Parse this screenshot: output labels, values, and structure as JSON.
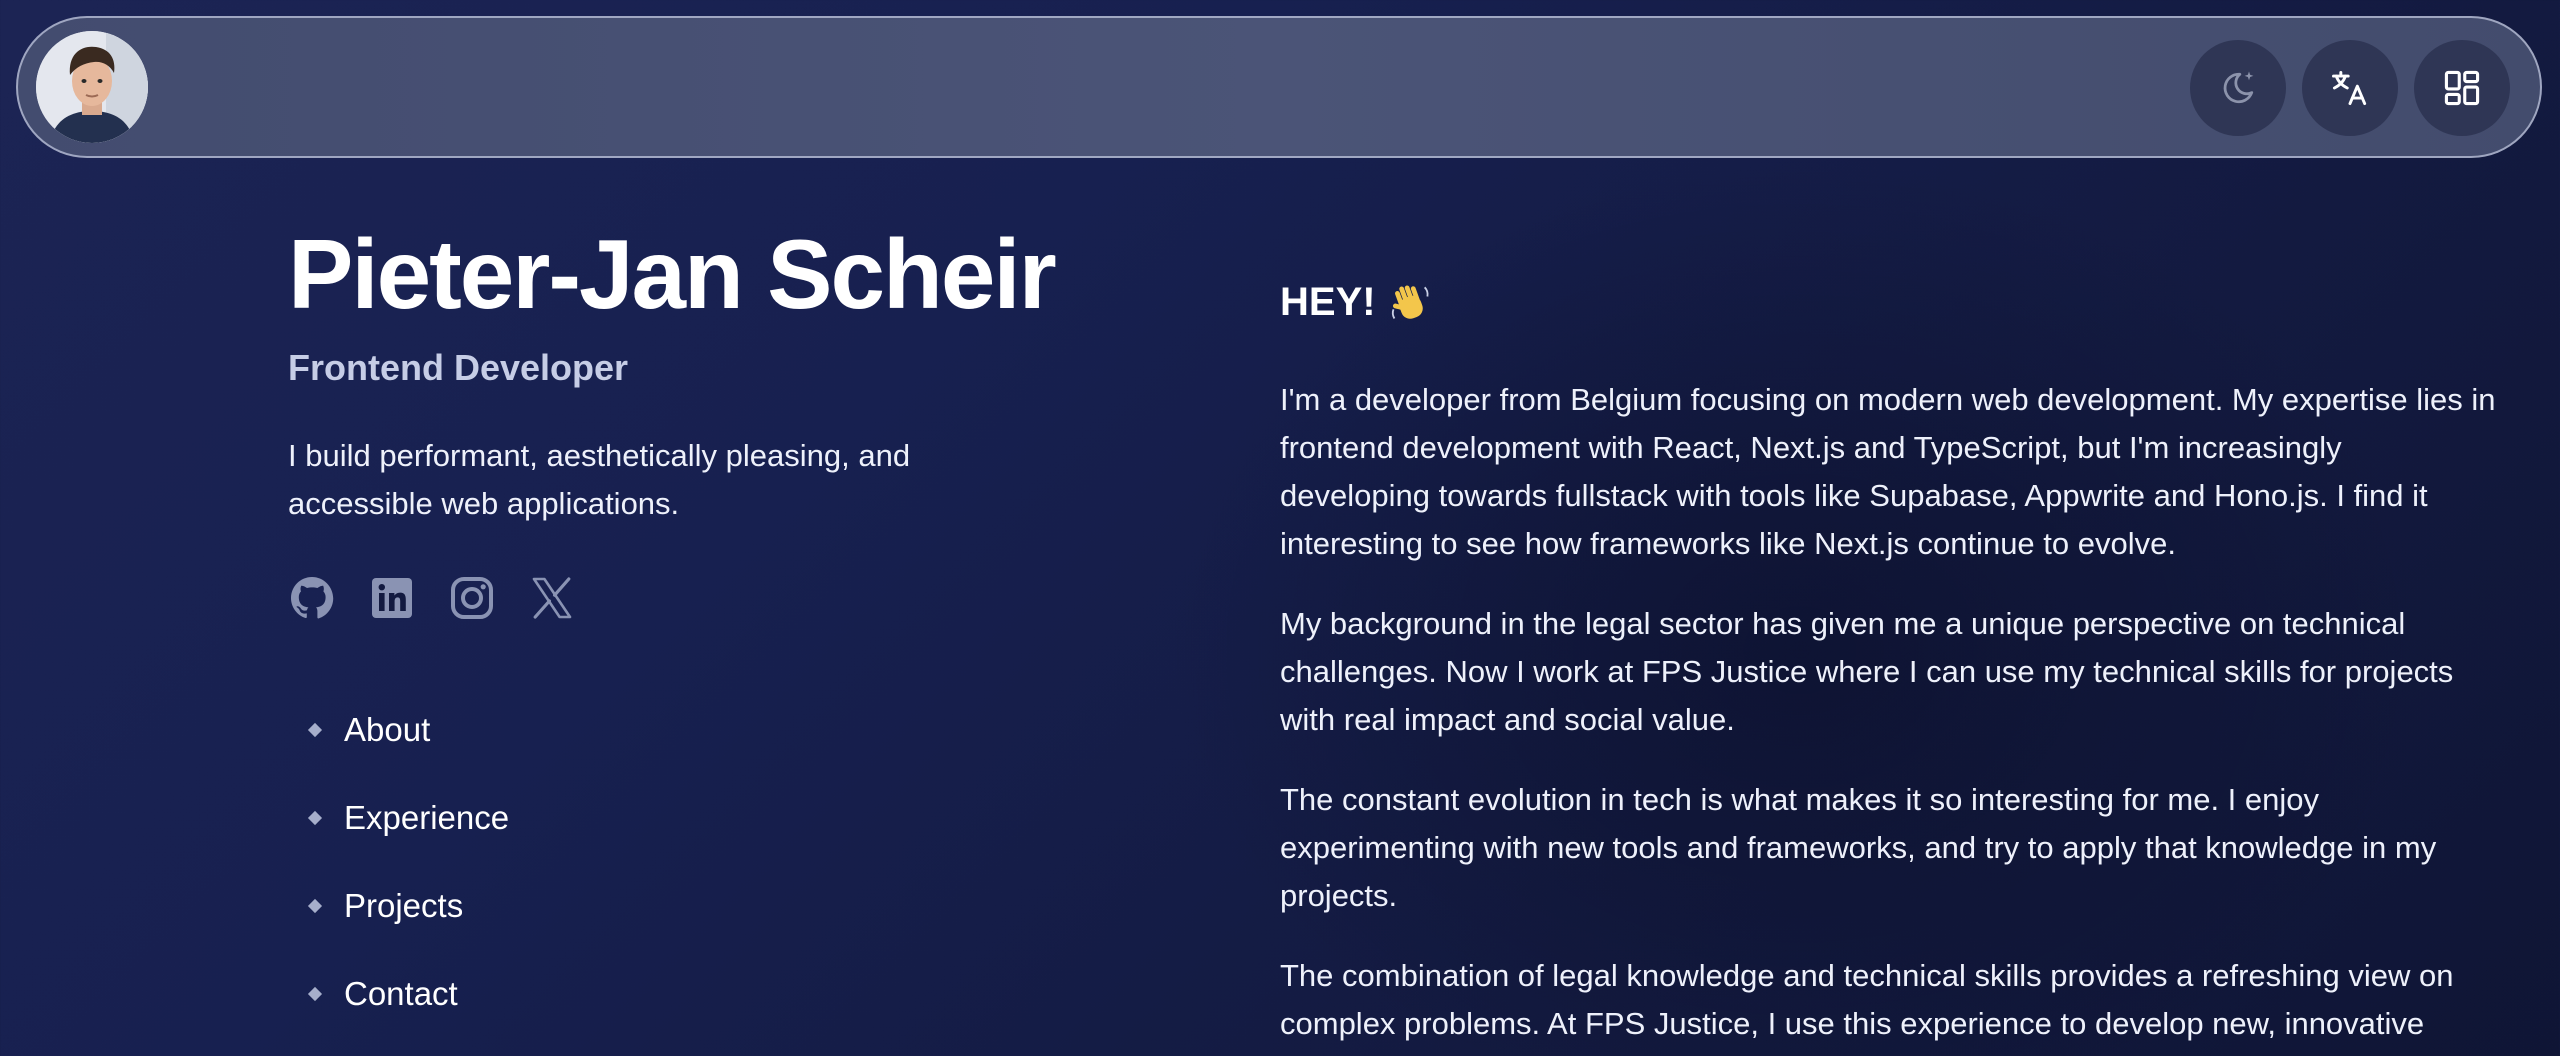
{
  "header": {
    "avatar_alt": "Profile photo",
    "buttons": [
      {
        "name": "theme-toggle-button",
        "icon": "moon-stars-icon"
      },
      {
        "name": "language-button",
        "icon": "translate-icon"
      },
      {
        "name": "apps-menu-button",
        "icon": "grid-icon"
      }
    ]
  },
  "profile": {
    "name": "Pieter-Jan Scheir",
    "role": "Frontend Developer",
    "tagline": "I build performant, aesthetically pleasing, and accessible web applications."
  },
  "socials": [
    {
      "icon": "github-icon"
    },
    {
      "icon": "linkedin-icon"
    },
    {
      "icon": "instagram-icon"
    },
    {
      "icon": "x-icon"
    }
  ],
  "nav": {
    "items": [
      "About",
      "Experience",
      "Projects",
      "Contact"
    ]
  },
  "about": {
    "heading": "HEY!",
    "heading_emoji": "waving-hand-icon",
    "paragraphs": [
      "I'm a developer from Belgium focusing on modern web development. My expertise lies in frontend development with React, Next.js and TypeScript, but I'm increasingly developing towards fullstack with tools like Supabase, Appwrite and Hono.js. I find it interesting to see how frameworks like Next.js continue to evolve.",
      "My background in the legal sector has given me a unique perspective on technical challenges. Now I work at FPS Justice where I can use my technical skills for projects with real impact and social value.",
      "The constant evolution in tech is what makes it so interesting for me. I enjoy experimenting with new tools and frameworks, and try to apply that knowledge in my projects.",
      "The combination of legal knowledge and technical skills provides a refreshing view on complex problems. At FPS Justice, I use this experience to develop new, innovative"
    ]
  },
  "colors": {
    "background": "#172050",
    "header_bar": "#4b5477",
    "header_button": "#2f3655",
    "role_text": "#c6cde6",
    "icon_muted": "#8a93b3"
  }
}
